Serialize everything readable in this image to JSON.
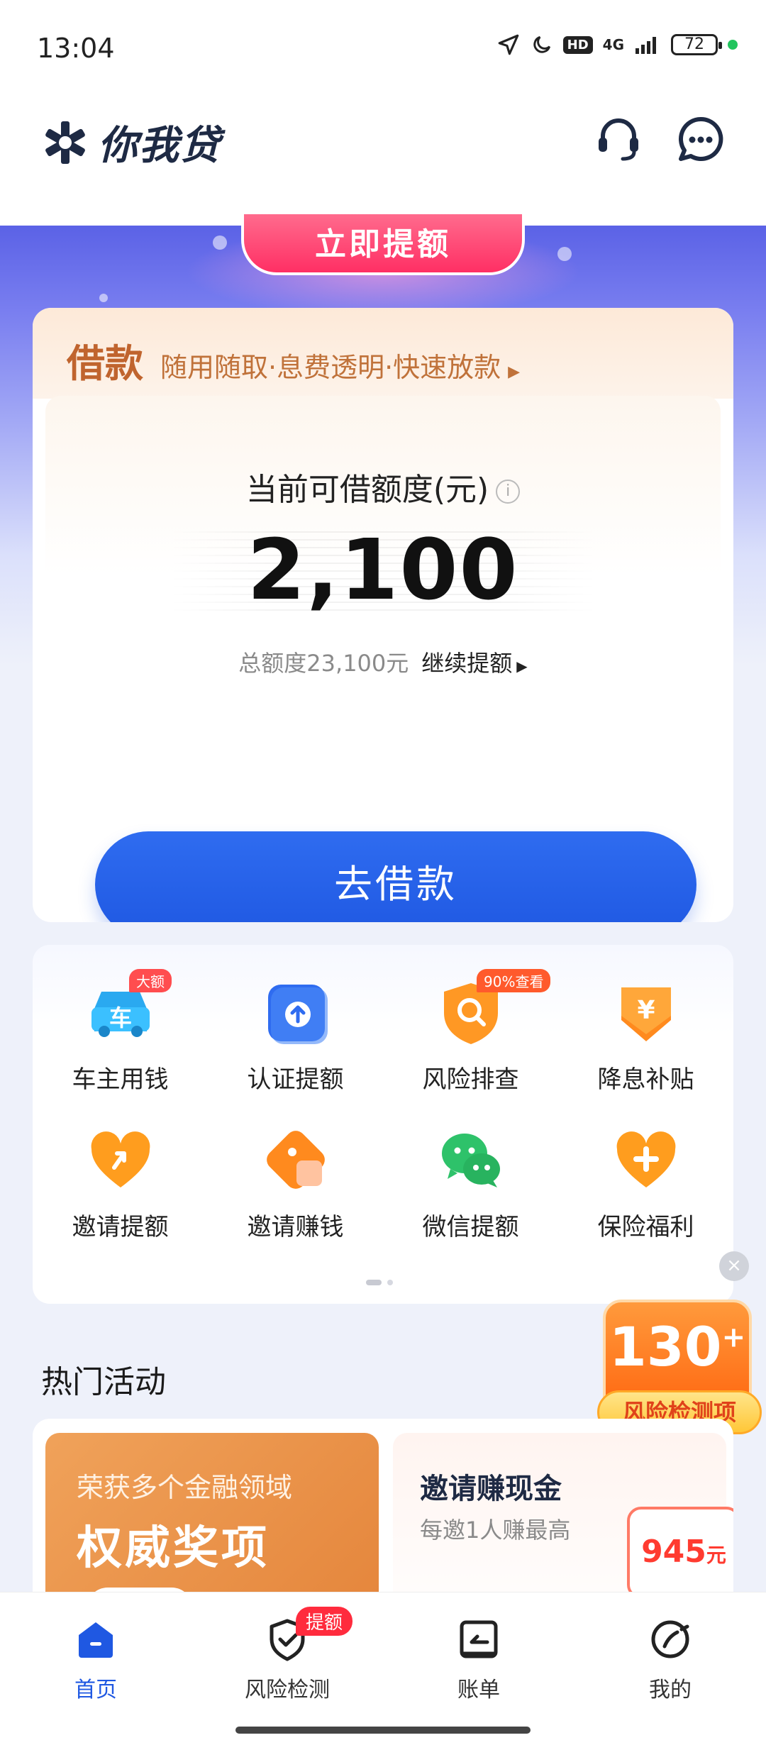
{
  "status_bar": {
    "time": "13:04",
    "network": "4G",
    "hd": "HD",
    "battery": "72"
  },
  "header": {
    "app_name": "你我贷"
  },
  "promo": {
    "button_label": "立即提额"
  },
  "loan": {
    "title": "借款",
    "tagline": "随用随取·息费透明·快速放款",
    "limit_label": "当前可借额度(元)",
    "limit_amount": "2,100",
    "total_label": "总额度23,100元",
    "continue_label": "继续提额",
    "borrow_button": "去借款"
  },
  "services": [
    {
      "label": "车主用钱",
      "badge": "大额",
      "icon": "car-icon"
    },
    {
      "label": "认证提额",
      "badge": "",
      "icon": "upload-arrow-icon"
    },
    {
      "label": "风险排查",
      "badge": "90%查看",
      "icon": "shield-search-icon"
    },
    {
      "label": "降息补贴",
      "badge": "",
      "icon": "yen-shield-icon"
    },
    {
      "label": "邀请提额",
      "badge": "",
      "icon": "heart-arrow-icon"
    },
    {
      "label": "邀请赚钱",
      "badge": "",
      "icon": "wallet-icon"
    },
    {
      "label": "微信提额",
      "badge": "",
      "icon": "wechat-icon"
    },
    {
      "label": "保险福利",
      "badge": "",
      "icon": "heart-plus-icon"
    }
  ],
  "risk_float": {
    "count": "130",
    "plus": "+",
    "label": "风险检测项"
  },
  "hot_activities": {
    "title": "热门活动",
    "card1": {
      "subtitle": "荣获多个金融领域",
      "title": "权威奖项"
    },
    "card2": {
      "title": "邀请赚现金",
      "subtitle": "每邀1人赚最高",
      "amount": "945",
      "unit": "元"
    }
  },
  "nav": [
    {
      "label": "首页",
      "active": true
    },
    {
      "label": "风险检测",
      "badge": "提额"
    },
    {
      "label": "账单"
    },
    {
      "label": "我的"
    }
  ],
  "colors": {
    "primary": "#1f58e2",
    "accent_orange": "#ff6a13",
    "banner_purple": "#5b62e6"
  }
}
